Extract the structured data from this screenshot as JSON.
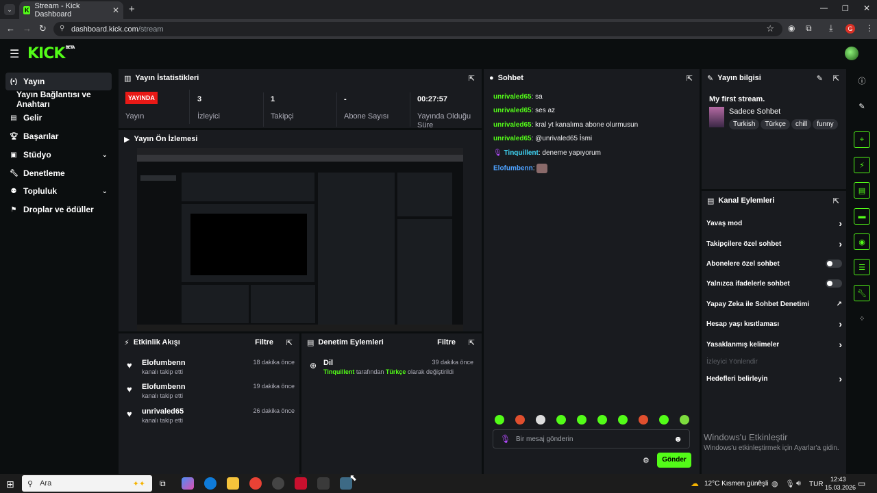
{
  "browser": {
    "tab_title": "Stream - Kick Dashboard",
    "url_host": "dashboard.kick.com",
    "url_path": "/stream",
    "profile_letter": "G"
  },
  "app": {
    "logo": "KICK",
    "logo_sup": "BETA"
  },
  "sidebar": {
    "items": [
      {
        "label": "Yayın",
        "icon": "broadcast-icon"
      },
      {
        "label": "Yayın Bağlantısı ve Anahtarı",
        "icon": ""
      },
      {
        "label": "Gelir",
        "icon": "chart-icon"
      },
      {
        "label": "Başarılar",
        "icon": "trophy-icon"
      },
      {
        "label": "Stüdyo",
        "icon": "studio-icon"
      },
      {
        "label": "Denetleme",
        "icon": "wrench-icon"
      },
      {
        "label": "Topluluk",
        "icon": "people-icon"
      },
      {
        "label": "Droplar ve ödüller",
        "icon": "gift-icon"
      }
    ]
  },
  "stats": {
    "title": "Yayın İstatistikleri",
    "live_badge": "YAYINDA",
    "status_label": "Yayın",
    "viewers": {
      "value": "3",
      "label": "İzleyici"
    },
    "followers": {
      "value": "1",
      "label": "Takipçi"
    },
    "subs": {
      "value": "-",
      "label": "Abone Sayısı"
    },
    "duration": {
      "value": "00:27:57",
      "label": "Yayında Olduğu Süre"
    }
  },
  "preview": {
    "title": "Yayın Ön İzlemesi"
  },
  "activity": {
    "title": "Etkinlik Akışı",
    "filter": "Filtre",
    "items": [
      {
        "name": "Elofumbenn",
        "sub": "kanalı takip etti",
        "time": "18 dakika önce"
      },
      {
        "name": "Elofumbenn",
        "sub": "kanalı takip etti",
        "time": "19 dakika önce"
      },
      {
        "name": "unrivaled65",
        "sub": "kanalı takip etti",
        "time": "26 dakika önce"
      }
    ]
  },
  "moderation": {
    "title": "Denetim Eylemleri",
    "filter": "Filtre",
    "item": {
      "title": "Dil",
      "time": "39 dakika önce",
      "user": "Tinquillent",
      "mid": "tarafından",
      "lang": "Türkçe",
      "end": "olarak değiştirildi"
    }
  },
  "chat": {
    "title": "Sohbet",
    "messages": [
      {
        "user": "unrivaled65",
        "text": ": sa"
      },
      {
        "user": "unrivaled65",
        "text": ": ses az"
      },
      {
        "user": "unrivaled65",
        "text": ": kral yt kanalıma abone olurmusun"
      },
      {
        "user": "unrivaled65",
        "text": ": @unrivaled65 İsmi"
      },
      {
        "user": "Tinquillent",
        "text": ": deneme yapıyorum"
      },
      {
        "user": "Elofumbenn",
        "text": ":"
      }
    ],
    "input_placeholder": "Bir mesaj gönderin",
    "send": "Gönder"
  },
  "stream_info": {
    "title": "Yayın bilgisi",
    "stream_title": "My first stream.",
    "category": "Sadece Sohbet",
    "tags": [
      "Turkish",
      "Türkçe",
      "chill",
      "funny"
    ]
  },
  "channel_actions": {
    "title": "Kanal Eylemleri",
    "items": [
      {
        "label": "Yavaş mod",
        "type": "chevron"
      },
      {
        "label": "Takipçilere özel sohbet",
        "type": "chevron"
      },
      {
        "label": "Abonelere özel sohbet",
        "type": "toggle"
      },
      {
        "label": "Yalnızca ifadelerle sohbet",
        "type": "toggle"
      },
      {
        "label": "Yapay Zeka ile Sohbet Denetimi",
        "type": "external"
      },
      {
        "label": "Hesap yaşı kısıtlaması",
        "type": "chevron"
      },
      {
        "label": "Yasaklanmış kelimeler",
        "type": "chevron"
      },
      {
        "label": "İzleyici Yönlendir",
        "type": "disabled"
      },
      {
        "label": "Hedefleri belirleyin",
        "type": "chevron"
      }
    ]
  },
  "watermark": {
    "line1": "Windows'u Etkinleştir",
    "line2": "Windows'u etkinleştirmek için Ayarlar'a gidin."
  },
  "taskbar": {
    "search": "Ara",
    "weather": "12°C  Kısmen güneşli",
    "lang": "TUR",
    "time": "12:43",
    "date": "15.03.2026"
  },
  "colors": {
    "accent": "#53fc18",
    "live": "#e91916",
    "panel": "#191b1f",
    "bg": "#0b0e0f"
  }
}
